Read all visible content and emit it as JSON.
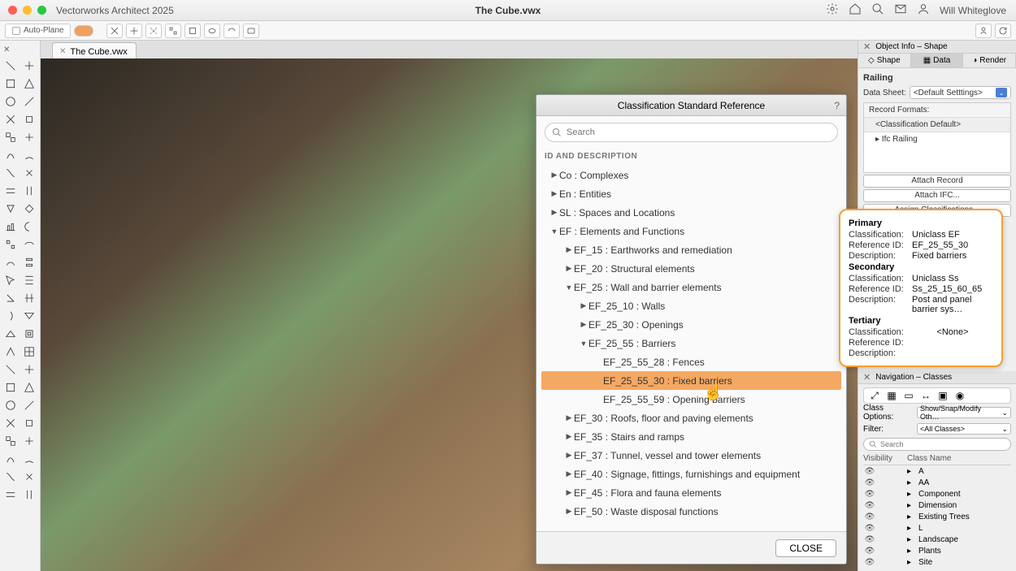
{
  "app_name": "Vectorworks Architect 2025",
  "file_name": "The Cube.vwx",
  "user_name": "Will Whiteglove",
  "toolbar": {
    "auto_plane": "Auto-Plane"
  },
  "doc_tab": "The Cube.vwx",
  "dialog": {
    "title": "Classification Standard Reference",
    "help": "?",
    "search_placeholder": "Search",
    "section_header": "ID AND DESCRIPTION",
    "close": "CLOSE",
    "tree": [
      {
        "indent": 0,
        "arrow": "▶",
        "label": "Co : Complexes"
      },
      {
        "indent": 0,
        "arrow": "▶",
        "label": "En : Entities"
      },
      {
        "indent": 0,
        "arrow": "▶",
        "label": "SL : Spaces and Locations"
      },
      {
        "indent": 0,
        "arrow": "▼",
        "label": "EF : Elements and Functions"
      },
      {
        "indent": 1,
        "arrow": "▶",
        "label": "EF_15 : Earthworks and remediation"
      },
      {
        "indent": 1,
        "arrow": "▶",
        "label": "EF_20 : Structural elements"
      },
      {
        "indent": 1,
        "arrow": "▼",
        "label": "EF_25 : Wall and barrier elements"
      },
      {
        "indent": 2,
        "arrow": "▶",
        "label": "EF_25_10 : Walls"
      },
      {
        "indent": 2,
        "arrow": "▶",
        "label": "EF_25_30 : Openings"
      },
      {
        "indent": 2,
        "arrow": "▼",
        "label": "EF_25_55 : Barriers"
      },
      {
        "indent": 3,
        "arrow": "",
        "label": "EF_25_55_28 : Fences"
      },
      {
        "indent": 3,
        "arrow": "",
        "label": "EF_25_55_30 : Fixed barriers",
        "sel": true
      },
      {
        "indent": 3,
        "arrow": "",
        "label": "EF_25_55_59 : Opening barriers"
      },
      {
        "indent": 1,
        "arrow": "▶",
        "label": "EF_30 : Roofs, floor and paving elements"
      },
      {
        "indent": 1,
        "arrow": "▶",
        "label": "EF_35 : Stairs and ramps"
      },
      {
        "indent": 1,
        "arrow": "▶",
        "label": "EF_37 : Tunnel, vessel and tower elements"
      },
      {
        "indent": 1,
        "arrow": "▶",
        "label": "EF_40 : Signage, fittings, furnishings and equipment"
      },
      {
        "indent": 1,
        "arrow": "▶",
        "label": "EF_45 : Flora and fauna elements"
      },
      {
        "indent": 1,
        "arrow": "▶",
        "label": "EF_50 : Waste disposal functions"
      }
    ]
  },
  "obj_info": {
    "title": "Object Info – Shape",
    "tabs": {
      "shape": "Shape",
      "data": "Data",
      "render": "Render"
    },
    "obj_type": "Railing",
    "data_sheet_label": "Data Sheet:",
    "data_sheet_value": "<Default Setttings>",
    "record_formats": "Record Formats:",
    "rf_item1": "<Classification Default>",
    "rf_item2": "Ifc Railing",
    "attach_record": "Attach Record",
    "attach_ifc": "Attach IFC...",
    "assign_class": "Assign Classifications..."
  },
  "callout": {
    "primary": "Primary",
    "p_class_k": "Classification:",
    "p_class_v": "Uniclass EF",
    "p_ref_k": "Reference ID:",
    "p_ref_v": "EF_25_55_30",
    "p_desc_k": "Description:",
    "p_desc_v": "Fixed barriers",
    "secondary": "Secondary",
    "s_class_k": "Classification:",
    "s_class_v": "Uniclass Ss",
    "s_ref_k": "Reference ID:",
    "s_ref_v": "Ss_25_15_60_65",
    "s_desc_k": "Description:",
    "s_desc_v": "Post and panel barrier sys…",
    "tertiary": "Tertiary",
    "t_class_k": "Classification:",
    "t_ref_k": "Reference ID:",
    "t_desc_k": "Description:",
    "t_none": "<None>"
  },
  "nav": {
    "title": "Navigation – Classes",
    "class_options_label": "Class Options:",
    "class_options_value": "Show/Snap/Modify Oth…",
    "filter_label": "Filter:",
    "filter_value": "<All Classes>",
    "search_placeholder": "Search",
    "col_visibility": "Visibility",
    "col_classname": "Class Name",
    "tree": [
      {
        "label": "A"
      },
      {
        "label": "AA"
      },
      {
        "label": "Component"
      },
      {
        "label": "Dimension"
      },
      {
        "label": "Existing Trees"
      },
      {
        "label": "L"
      },
      {
        "label": "Landscape"
      },
      {
        "label": "Plants"
      },
      {
        "label": "Site"
      }
    ]
  }
}
